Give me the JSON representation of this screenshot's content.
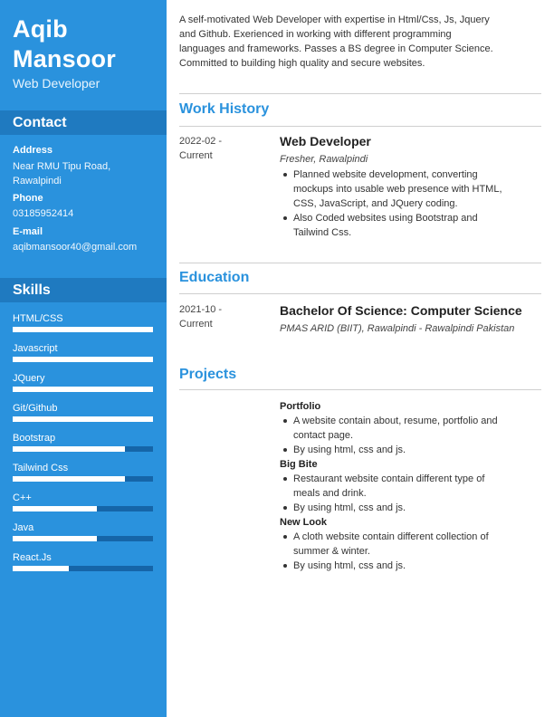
{
  "header": {
    "first_name": "Aqib",
    "last_name": "Mansoor",
    "role": "Web Developer"
  },
  "contact": {
    "heading": "Contact",
    "address_label": "Address",
    "address_line1": "Near RMU Tipu Road,",
    "address_line2": "Rawalpindi",
    "phone_label": "Phone",
    "phone": "03185952414",
    "email_label": "E-mail",
    "email": "aqibmansoor40@gmail.com"
  },
  "skills": {
    "heading": "Skills",
    "items": [
      {
        "name": "HTML/CSS",
        "level": 1.0
      },
      {
        "name": "Javascript",
        "level": 1.0
      },
      {
        "name": "JQuery",
        "level": 1.0
      },
      {
        "name": "Git/Github",
        "level": 1.0
      },
      {
        "name": "Bootstrap",
        "level": 0.8
      },
      {
        "name": "Tailwind Css",
        "level": 0.8
      },
      {
        "name": "C++",
        "level": 0.6
      },
      {
        "name": "Java",
        "level": 0.6
      },
      {
        "name": "React.Js",
        "level": 0.4
      }
    ]
  },
  "summary": {
    "line1": "A self-motivated Web Developer with expertise in Html/Css, Js, Jquery",
    "line2": "and Github. Exerienced in working with different programming",
    "line3": "languages and frameworks. Passes a BS degree in Computer Science.",
    "line4": "Committed to building high quality and secure websites."
  },
  "work": {
    "heading": "Work History",
    "date_line1": "2022-02 -",
    "date_line2": "Current",
    "title": "Web Developer",
    "subtitle": "Fresher, Rawalpindi",
    "bullets": [
      {
        "l1": "Planned website development, converting",
        "l2": "mockups into usable web presence with HTML,",
        "l3": "CSS, JavaScript, and JQuery coding."
      },
      {
        "l1": "Also Coded websites using Bootstrap and",
        "l2": "Tailwind Css."
      }
    ]
  },
  "education": {
    "heading": "Education",
    "date_line1": "2021-10 -",
    "date_line2": "Current",
    "title": "Bachelor Of Science: Computer Science",
    "subtitle": "PMAS ARID (BIIT), Rawalpindi - Rawalpindi Pakistan"
  },
  "projects": {
    "heading": "Projects",
    "items": [
      {
        "name": "Portfolio",
        "b1_l1": "A website contain about, resume, portfolio and",
        "b1_l2": "contact page.",
        "b2": "By using html, css and js."
      },
      {
        "name": "Big Bite",
        "b1_l1": "Restaurant website contain different type of",
        "b1_l2": "meals and drink.",
        "b2": "By using html, css and js."
      },
      {
        "name": "New Look",
        "b1_l1": "A cloth website contain different collection of",
        "b1_l2": "summer & winter.",
        "b2": "By using html, css and js."
      }
    ]
  }
}
